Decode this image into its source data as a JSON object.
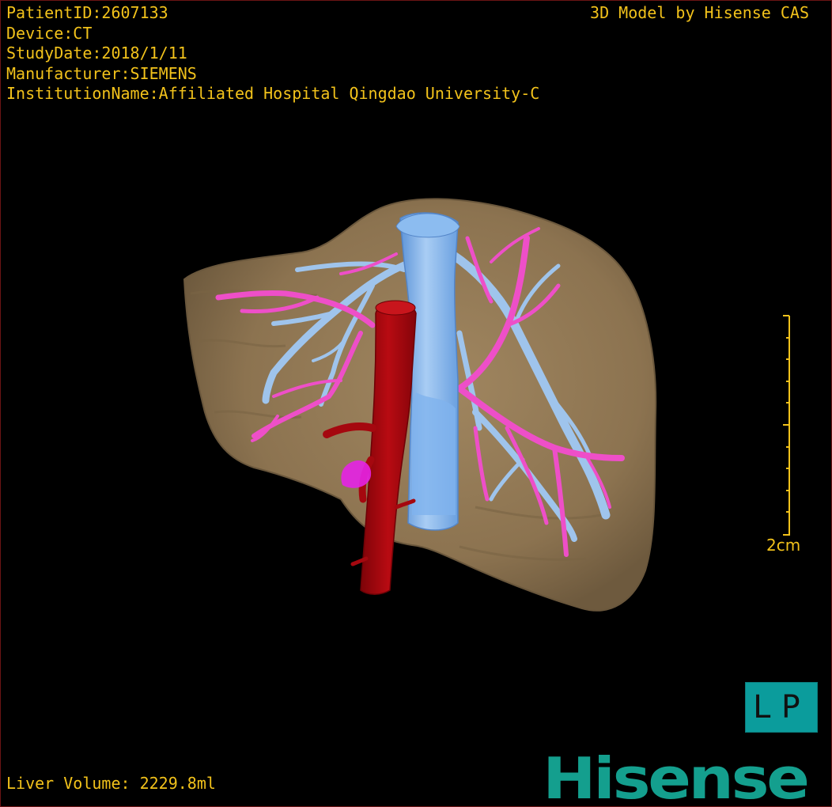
{
  "header": {
    "patient_id": "PatientID:2607133",
    "device": "Device:CT",
    "study_date": "StudyDate:2018/1/11",
    "manufacturer": "Manufacturer:SIEMENS",
    "institution": "InstitutionName:Affiliated Hospital Qingdao University-C",
    "credit": "3D Model by Hisense CAS"
  },
  "scale_bar": {
    "label": "2cm"
  },
  "orientation": {
    "label": "LP"
  },
  "footer": {
    "liver_volume": "Liver Volume: 2229.8ml",
    "brand": "Hisense"
  },
  "colors": {
    "text": "#f2c21b",
    "liver": "#8f7550",
    "hepatic_vein": "#9fc4ec",
    "portal_vein": "#ee4fc8",
    "vena_cava": "#7fb3ee",
    "aorta": "#a5080f",
    "brand": "#149f8e",
    "orientation_box": "#0b9c9c"
  }
}
